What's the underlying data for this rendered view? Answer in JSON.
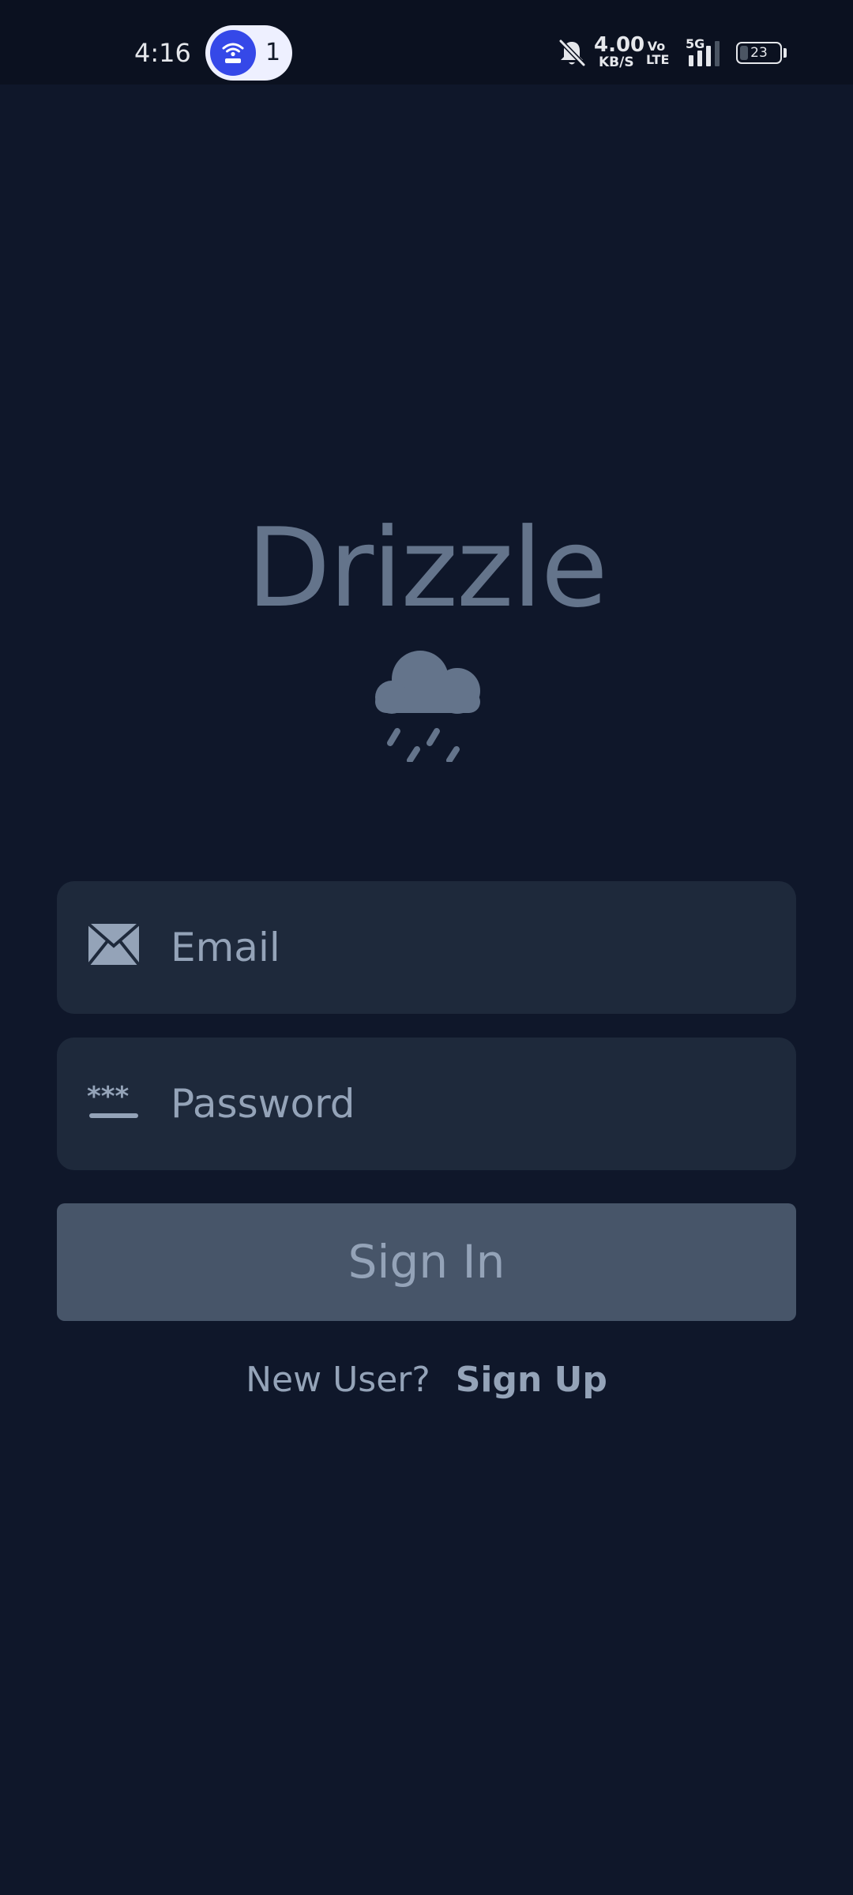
{
  "status_bar": {
    "time": "4:16",
    "notification_count": "1",
    "network_speed_value": "4.00",
    "network_speed_unit": "KB/S",
    "volte_label_top": "Vo",
    "volte_label_bottom": "LTE",
    "network_type": "5G",
    "battery_level": "23",
    "icons": [
      "hotspot-icon",
      "bell-muted-icon",
      "signal-icon",
      "battery-icon"
    ]
  },
  "brand": {
    "app_name": "Drizzle",
    "logo_icon": "rain-cloud-icon"
  },
  "form": {
    "email": {
      "value": "",
      "placeholder": "Email",
      "icon": "envelope-icon"
    },
    "password": {
      "value": "",
      "placeholder": "Password",
      "icon": "password-dots-icon"
    },
    "sign_in_label": "Sign In"
  },
  "footer": {
    "new_user_text": "New User?",
    "sign_up_label": "Sign Up"
  },
  "colors": {
    "background": "#0f172a",
    "field_background": "#1e293b",
    "button_background": "#475569",
    "muted_text": "#94a3b8",
    "brand_color": "#64748b",
    "hotspot_accent": "#3548e8"
  }
}
